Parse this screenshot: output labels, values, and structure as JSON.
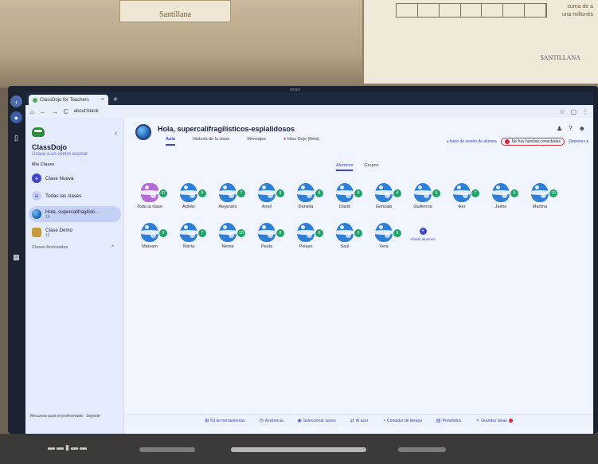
{
  "room": {
    "poster_left_text": "Santillana",
    "poster_right_brand": "SANTILLANA",
    "poster_right_note": [
      "suma de a",
      "una millonés"
    ],
    "monitor_label": "smart"
  },
  "browser": {
    "tab_title": "ClassDojo for Teachers",
    "tab_close": "×",
    "new_tab": "+",
    "address": "about:blank",
    "nav_back": "←",
    "nav_forward": "→",
    "nav_reload": "C",
    "home": "⌂"
  },
  "sidebar": {
    "brand": "ClassDojo",
    "join_link": "Únase a un centro escolar",
    "my_classes_label": "Mis Clases",
    "items": [
      {
        "label": "Clase Nueva",
        "icon": "plus-icon"
      },
      {
        "label": "Todas las clases",
        "icon": "list-icon"
      },
      {
        "label": "Hola, supercalifragilisti...",
        "sub": "15",
        "icon": "class-globe-icon",
        "active": true
      },
      {
        "label": "Clase Demo",
        "sub": "12",
        "icon": "class-demo-icon"
      }
    ],
    "archived_label": "Clases Archivadas",
    "footer": "Recursos para el profesorado  ·  Soporte"
  },
  "main": {
    "class_title": "Hola, supercalifragilísticos-espialidosos",
    "tabs": [
      "Aula",
      "Historia de la clase",
      "Mensajes",
      "Islas Dojo (Beta)"
    ],
    "active_tab": "Aula",
    "status_link": "Inicio de sesión de alumno",
    "alert_text": "No hay familias conectadas",
    "options": "Opciones",
    "subtabs": [
      "Alumnos",
      "Grupos"
    ],
    "active_subtab": "Alumnos",
    "students_row1": [
      {
        "name": "Toda la clase",
        "points": "37",
        "type": "all"
      },
      {
        "name": "Adrián",
        "points": "8"
      },
      {
        "name": "Alejandro",
        "points": "7"
      },
      {
        "name": "Amel",
        "points": "9"
      },
      {
        "name": "Daniela",
        "points": "8"
      },
      {
        "name": "David",
        "points": "8"
      },
      {
        "name": "Gonzalo",
        "points": "4"
      },
      {
        "name": "Guillermo",
        "points": "6"
      },
      {
        "name": "Iker",
        "points": "7"
      },
      {
        "name": "Jaime",
        "points": "6"
      },
      {
        "name": "Martina",
        "points": "10"
      }
    ],
    "students_row2": [
      {
        "name": "Maryam",
        "points": "9"
      },
      {
        "name": "María",
        "points": "7"
      },
      {
        "name": "Nerea",
        "points": "10"
      },
      {
        "name": "Paula",
        "points": "8"
      },
      {
        "name": "Pelayo",
        "points": "6"
      },
      {
        "name": "Saúl",
        "points": "9"
      },
      {
        "name": "Vera",
        "points": "9"
      }
    ],
    "add_student": "Añadir alumnos"
  },
  "bottombar": [
    {
      "label": "Kit de herramientas",
      "icon": "grid-icon"
    },
    {
      "label": "Asistencia",
      "icon": "clock-icon"
    },
    {
      "label": "Seleccionar varios",
      "icon": "select-icon"
    },
    {
      "label": "Al azar",
      "icon": "shuffle-icon"
    },
    {
      "label": "Contador de tiempo",
      "icon": "timer-icon"
    },
    {
      "label": "Portafolios",
      "icon": "portfolio-icon"
    },
    {
      "label": "Grandes ideas",
      "icon": "idea-icon"
    }
  ],
  "colors": {
    "accent": "#3d45c9",
    "badge": "#20a366",
    "egg": "#2e7fd8",
    "sidebar_active": "#c4d0f4"
  }
}
